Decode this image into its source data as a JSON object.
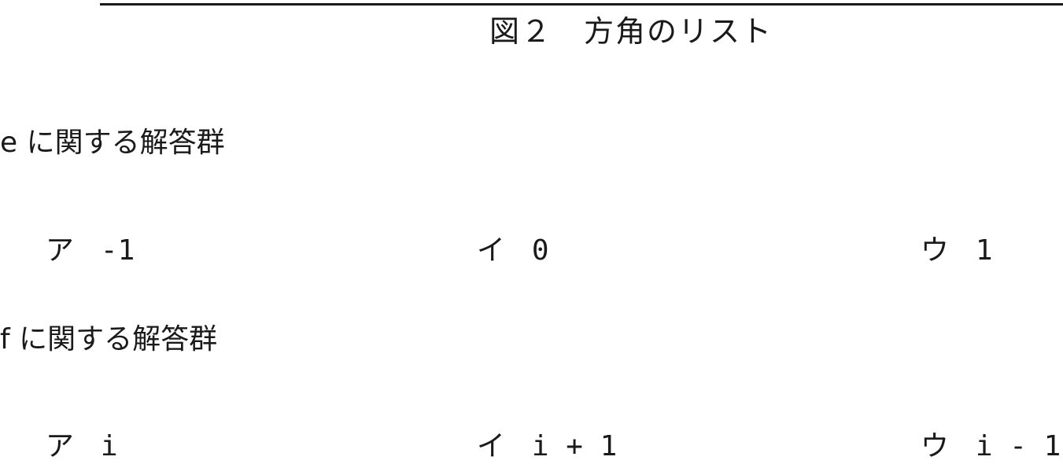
{
  "figure_caption": "図２　方角のリスト",
  "groups": [
    {
      "heading": "e に関する解答群",
      "choices": [
        {
          "label": "ア",
          "value": "-1"
        },
        {
          "label": "イ",
          "value": "0"
        },
        {
          "label": "ウ",
          "value": "1"
        }
      ]
    },
    {
      "heading": "f に関する解答群",
      "choices": [
        {
          "label": "ア",
          "value": "i"
        },
        {
          "label": "イ",
          "value": "i + 1"
        },
        {
          "label": "ウ",
          "value": "i - 1"
        }
      ]
    }
  ]
}
